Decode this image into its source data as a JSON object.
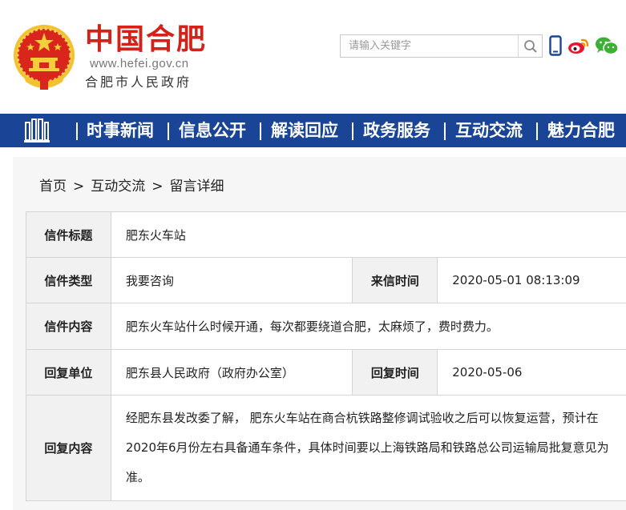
{
  "header": {
    "title": "中国合肥",
    "url": "www.hefei.gov.cn",
    "gov_name": "合肥市人民政府",
    "emblem_icon": "national-emblem-icon",
    "search": {
      "placeholder": "请输入关键字",
      "icon": "search-icon"
    },
    "icons": [
      "mobile-icon",
      "weibo-icon",
      "wechat-icon"
    ]
  },
  "nav": {
    "logo_icon": "building-logo-icon",
    "items": [
      {
        "label": "时事新闻"
      },
      {
        "label": "信息公开"
      },
      {
        "label": "解读回应"
      },
      {
        "label": "政务服务"
      },
      {
        "label": "互动交流"
      },
      {
        "label": "魅力合肥"
      }
    ]
  },
  "breadcrumb": [
    "首页",
    "互动交流",
    "留言详细"
  ],
  "letter": {
    "title_label": "信件标题",
    "title_value": "肥东火车站",
    "type_label": "信件类型",
    "type_value": "我要咨询",
    "received_label": "来信时间",
    "received_value": "2020-05-01 08:13:09",
    "content_label": "信件内容",
    "content_value": "肥东火车站什么时候开通，每次都要绕道合肥，太麻烦了，费时费力。",
    "reply_unit_label": "回复单位",
    "reply_unit_value": "肥东县人民政府（政府办公室）",
    "reply_time_label": "回复时间",
    "reply_time_value": "2020-05-06",
    "reply_content_label": "回复内容",
    "reply_content_value": "经肥东县发改委了解， 肥东火车站在商合杭铁路整修调试验收之后可以恢复运营，预计在2020年6月份左右具备通车条件，具体时间要以上海铁路局和铁路总公司运输局批复意见为准。"
  },
  "colors": {
    "brand_red": "#d2221a",
    "nav_blue": "#1a4596",
    "label_blue": "#1a4596",
    "weibo_red": "#e6162d",
    "wechat_green": "#3cb034"
  }
}
